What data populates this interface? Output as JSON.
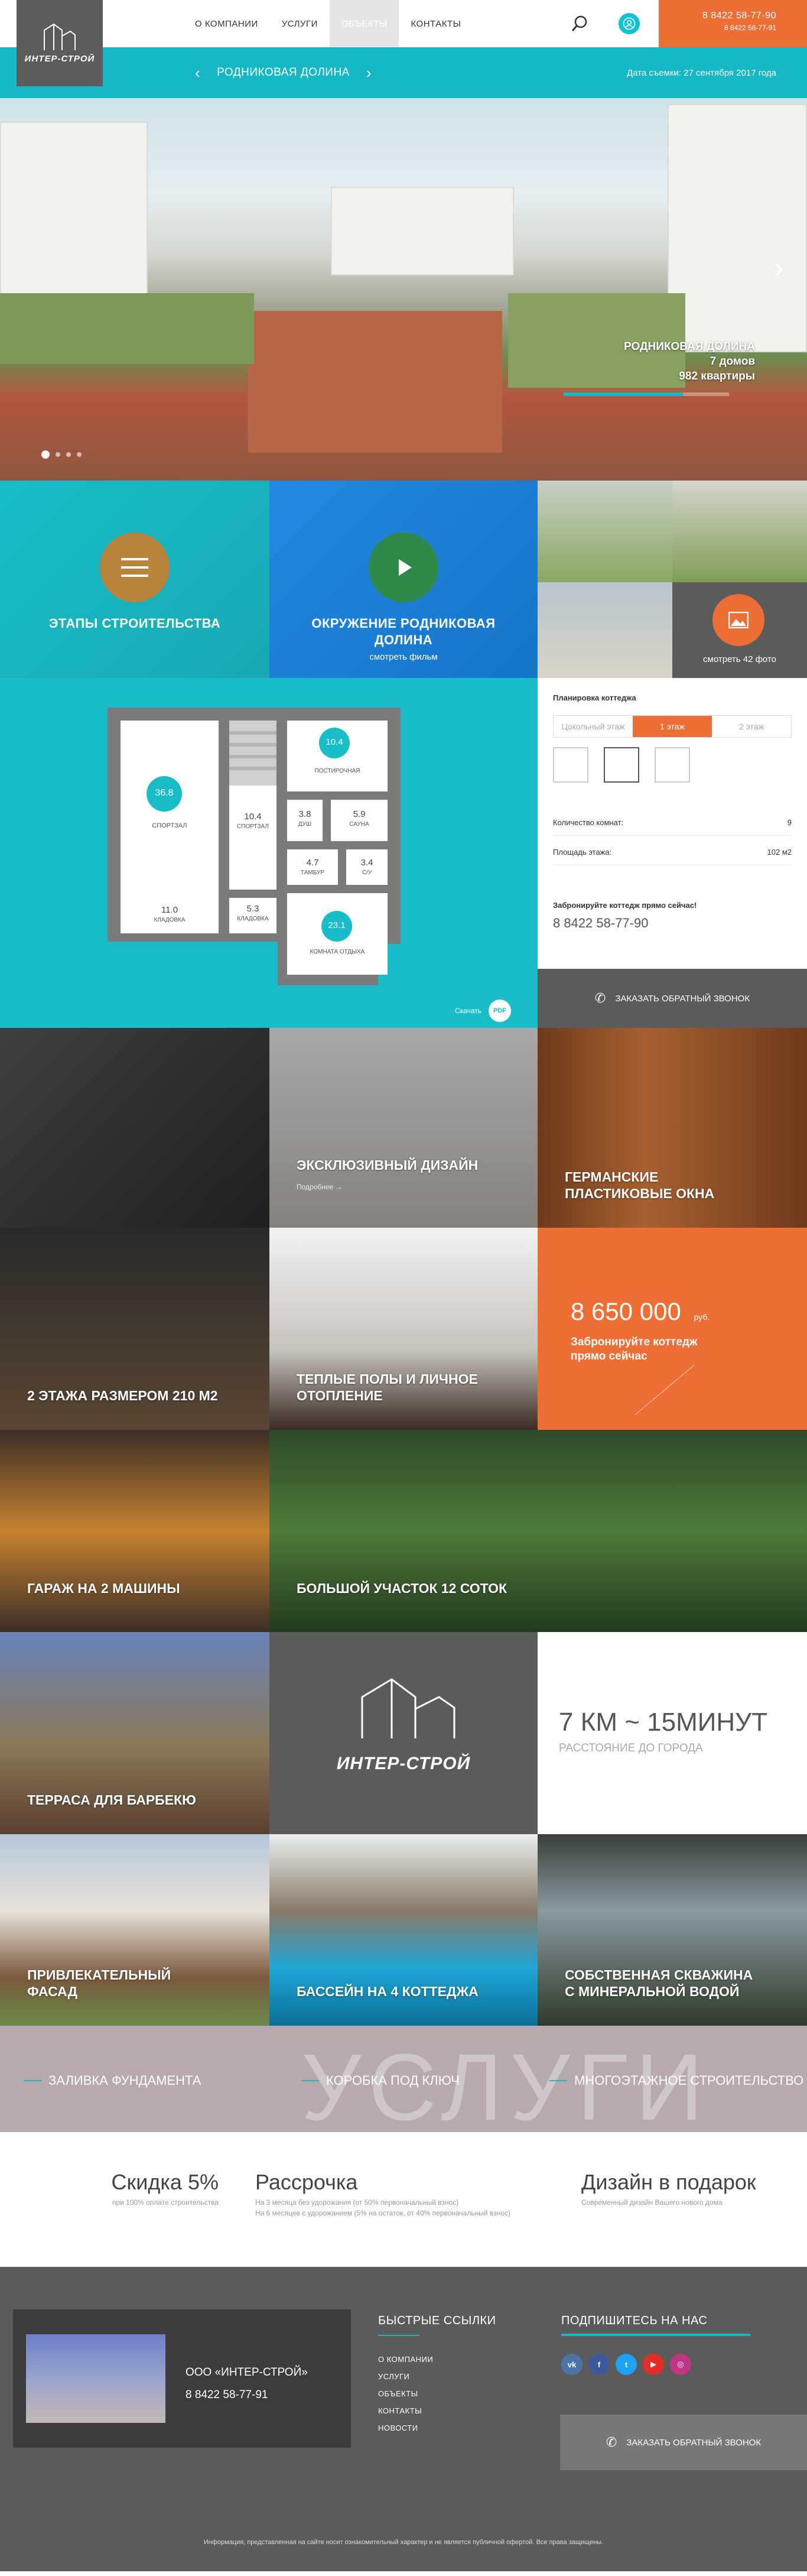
{
  "header": {
    "logo_text": "ИНТЕР-СТРОЙ",
    "nav": [
      "О КОМПАНИИ",
      "УСЛУГИ",
      "ОБЪЕКТЫ",
      "КОНТАКТЫ"
    ],
    "active_nav": 2,
    "phone_main": "8 8422 58-77-90",
    "phone_secondary": "8 8422 58-77-91",
    "icons": {
      "search": "search-icon",
      "user": "user-icon"
    }
  },
  "location": {
    "title": "РОДНИКОВАЯ ДОЛИНА",
    "date": "Дата съемки: 27 сентября 2017 года"
  },
  "hero": {
    "caption_title": "РОДНИКОВАЯ ДОЛИНА",
    "caption_houses": "7 домов",
    "caption_flats": "982 квартиры",
    "progress": 0.72
  },
  "tiles": [
    {
      "title": "ЭТАПЫ СТРОИТЕЛЬСТВА",
      "sub": "",
      "icon": "menu-icon"
    },
    {
      "title": "ОКРУЖЕНИЕ РОДНИКОВАЯ ДОЛИНА",
      "sub": "смотреть фильм",
      "icon": "play-icon"
    },
    {
      "title": "",
      "sub": "смотреть 42 фото",
      "icon": "image-icon"
    }
  ],
  "plan": {
    "heading": "Планировка коттеджа",
    "floor_tabs": [
      "Цокольный этаж",
      "1 этаж",
      "2 этаж"
    ],
    "active_floor": 1,
    "rooms_label": "Количество комнат:",
    "rooms_value": "9",
    "area_label": "Площадь этажа:",
    "area_value": "102 м2",
    "order_title": "Забронируйте коттедж прямо сейчас!",
    "order_phone": "8 8422 58-77-90",
    "callback": "ЗАКАЗАТЬ ОБРАТНЫЙ ЗВОНОК",
    "download": "Скачать",
    "pdf": "PDF",
    "rooms": [
      {
        "area": "36.8",
        "name": "СПОРТЗАЛ"
      },
      {
        "area": "10.4",
        "name": "ПОСТИРОЧНАЯ"
      },
      {
        "area": "10.4",
        "name": "СПОРТЗАЛ"
      },
      {
        "area": "3.8",
        "name": "ДУШ"
      },
      {
        "area": "5.9",
        "name": "САУНА"
      },
      {
        "area": "4.7",
        "name": "ТАМБУР"
      },
      {
        "area": "3.4",
        "name": "С/У"
      },
      {
        "area": "11.0",
        "name": "КЛАДОВКА"
      },
      {
        "area": "5.3",
        "name": "КЛАДОВКА"
      },
      {
        "area": "23.1",
        "name": "КОМНАТА ОТДЫХА"
      }
    ]
  },
  "features": [
    {
      "title": "",
      "more": ""
    },
    {
      "title": "ЭКСКЛЮЗИВНЫЙ ДИЗАЙН",
      "more": "Подробнее →"
    },
    {
      "title": "ГЕРМАНСКИЕ ПЛАСТИКОВЫЕ ОКНА",
      "more": ""
    },
    {
      "title": "2 ЭТАЖА РАЗМЕРОМ 210 М2",
      "more": ""
    },
    {
      "title": "ТЕПЛЫЕ ПОЛЫ И ЛИЧНОЕ ОТОПЛЕНИЕ",
      "more": ""
    },
    {
      "title": "ГАРАЖ НА 2 МАШИНЫ",
      "more": ""
    },
    {
      "title": "БОЛЬШОЙ УЧАСТОК 12 СОТОК",
      "more": ""
    },
    {
      "title": "ТЕРРАСА ДЛЯ БАРБЕКЮ",
      "more": ""
    },
    {
      "title": "ПРИВЛЕКАТЕЛЬНЫЙ ФАСАД",
      "more": ""
    },
    {
      "title": "БАССЕЙН НА 4 КОТТЕДЖА",
      "more": ""
    },
    {
      "title": "СОБСТВЕННАЯ СКВАЖИНА С МИНЕРАЛЬНОЙ ВОДОЙ",
      "more": ""
    }
  ],
  "price": {
    "value": "8 650 000",
    "currency": "руб.",
    "text": "Забронируйте коттедж прямо сейчас"
  },
  "brand_tile": {
    "logo_text": "ИНТЕР-СТРОЙ"
  },
  "distance": {
    "value": "7 КМ ~ 15МИНУТ",
    "label": "РАССТОЯНИЕ ДО ГОРОДА"
  },
  "services": {
    "watermark": "УСЛУГИ",
    "items": [
      "ЗАЛИВКА ФУНДАМЕНТА",
      "КОРОБКА ПОД КЛЮЧ",
      "МНОГОЭТАЖНОЕ СТРОИТЕЛЬСТВО"
    ]
  },
  "promos": [
    {
      "title": "Скидка 5%",
      "desc": [
        "при 100% оплате строительства"
      ]
    },
    {
      "title": "Рассрочка",
      "desc": [
        "На 3 месяца без удорожания (от 50% первоначальный взнос)",
        "На 6 месяцев с удорожанием (5% на остаток, от 40% первоначальный взнос)"
      ]
    },
    {
      "title": "Дизайн в подарок",
      "desc": [
        "Современный дизайн Вашего нового дома"
      ]
    }
  ],
  "footer": {
    "company": "ООО «ИНТЕР-СТРОЙ»",
    "phone": "8 8422 58-77-91",
    "links_title": "БЫСТРЫЕ ССЫЛКИ",
    "links": [
      "О КОМПАНИИ",
      "УСЛУГИ",
      "ОБЪЕКТЫ",
      "КОНТАКТЫ",
      "НОВОСТИ"
    ],
    "social_title": "ПОДПИШИТЕСЬ НА НАС",
    "social": [
      {
        "icon": "vk-icon",
        "glyph": "vk",
        "color": "#4a76a8"
      },
      {
        "icon": "facebook-icon",
        "glyph": "f",
        "color": "#3b5998"
      },
      {
        "icon": "twitter-icon",
        "glyph": "t",
        "color": "#1da1f2"
      },
      {
        "icon": "youtube-icon",
        "glyph": "▶",
        "color": "#e52d27"
      },
      {
        "icon": "instagram-icon",
        "glyph": "◎",
        "color": "#c13584"
      }
    ],
    "callback": "ЗАКАЗАТЬ ОБРАТНЫЙ ЗВОНОК",
    "copyright": "Информация, представленная на сайте носит ознакомительный характер и не является публичной офертой. Все права защищены."
  }
}
